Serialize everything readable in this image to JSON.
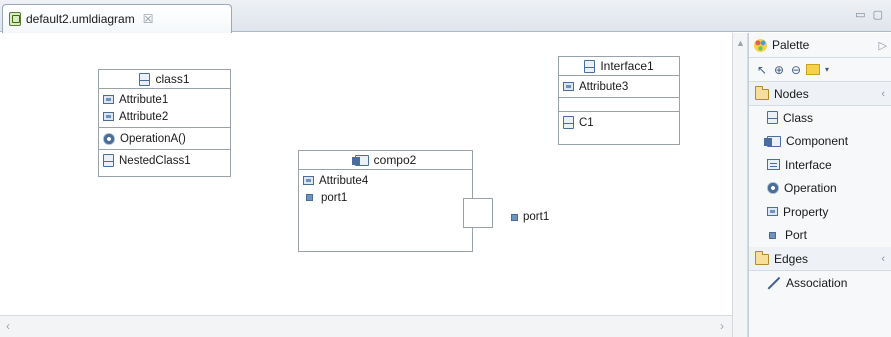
{
  "tab": {
    "label": "default2.umldiagram",
    "close": "☒"
  },
  "window_controls": "▭ ▢",
  "diagram": {
    "class1": {
      "name": "class1",
      "attributes": [
        "Attribute1",
        "Attribute2"
      ],
      "operations": [
        "OperationA()"
      ],
      "nested": [
        "NestedClass1"
      ]
    },
    "compo2": {
      "name": "compo2",
      "attributes": [
        "Attribute4"
      ],
      "ports": [
        "port1"
      ]
    },
    "interface1": {
      "name": "Interface1",
      "attributes": [
        "Attribute3"
      ],
      "nested": [
        "C1"
      ]
    },
    "external_port": "port1"
  },
  "palette": {
    "title": "Palette",
    "sections": {
      "nodes": {
        "label": "Nodes",
        "items": [
          "Class",
          "Component",
          "Interface",
          "Operation",
          "Property",
          "Port"
        ]
      },
      "edges": {
        "label": "Edges",
        "items": [
          "Association"
        ]
      }
    }
  }
}
